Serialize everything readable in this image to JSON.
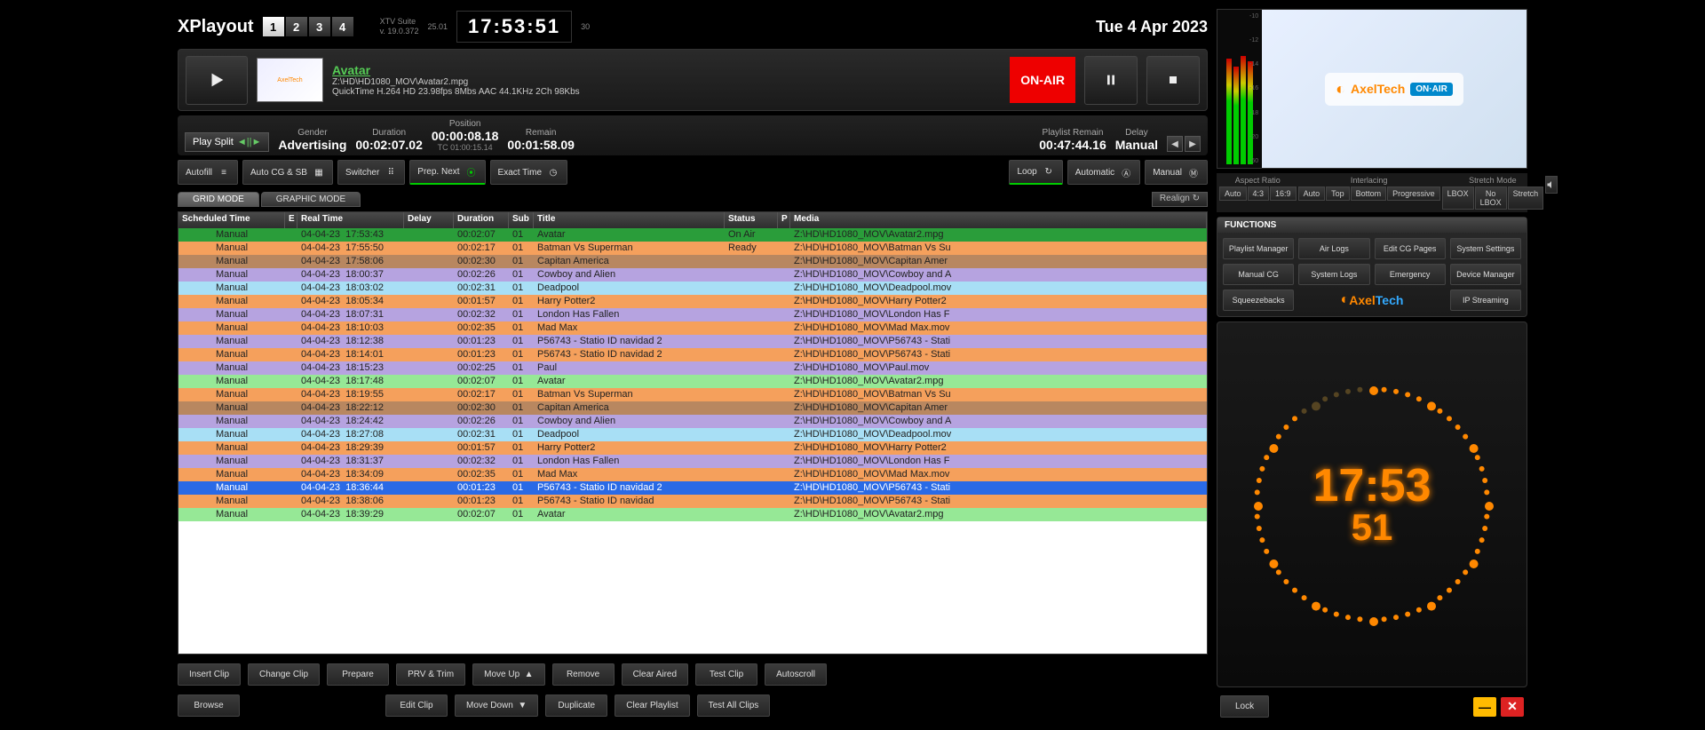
{
  "app": {
    "title": "XPlayout",
    "suite": "XTV Suite",
    "version": "v. 19.0.372"
  },
  "channels": [
    "1",
    "2",
    "3",
    "4"
  ],
  "clock_small_left": "25.01",
  "clock": "17:53:51",
  "clock_small_right": "30",
  "date": "Tue 4 Apr 2023",
  "now_playing": {
    "title": "Avatar",
    "path": "Z:\\HD\\HD1080_MOV\\Avatar2.mpg",
    "codec": "QuickTime H.264 HD 23.98fps 8Mbs AAC 44.1KHz 2Ch 98Kbs",
    "onair": "ON-AIR"
  },
  "play_split": "Play Split",
  "stats": {
    "gender": {
      "label": "Gender",
      "value": "Advertising"
    },
    "duration": {
      "label": "Duration",
      "value": "00:02:07.02"
    },
    "position": {
      "label": "Position",
      "value": "00:00:08.18",
      "tc": "TC 01:00:15.14"
    },
    "remain": {
      "label": "Remain",
      "value": "00:01:58.09"
    },
    "playlist_remain": {
      "label": "Playlist Remain",
      "value": "00:47:44.16"
    },
    "delay": {
      "label": "Delay",
      "value": "Manual"
    }
  },
  "mode_btns": {
    "autofill": "Autofill",
    "autocg": "Auto CG & SB",
    "switcher": "Switcher",
    "prepnext": "Prep. Next",
    "exacttime": "Exact Time",
    "loop": "Loop",
    "automatic": "Automatic",
    "manual": "Manual"
  },
  "tabs": {
    "grid": "GRID MODE",
    "graphic": "GRAPHIC MODE",
    "realign": "Realign"
  },
  "columns": {
    "sched": "Scheduled Time",
    "e": "E",
    "real": "Real Time",
    "delay": "Delay",
    "dur": "Duration",
    "sub": "Sub",
    "title": "Title",
    "status": "Status",
    "p": "P",
    "media": "Media"
  },
  "rows": [
    {
      "sched": "Manual",
      "rd": "04-04-23",
      "rt": "17:53:43",
      "dur": "00:02:07",
      "sub": "01",
      "title": "Avatar",
      "status": "On Air",
      "media": "Z:\\HD\\HD1080_MOV\\Avatar2.mpg",
      "color": "#2a9d3a"
    },
    {
      "sched": "Manual",
      "rd": "04-04-23",
      "rt": "17:55:50",
      "dur": "00:02:17",
      "sub": "01",
      "title": "Batman Vs Superman",
      "status": "Ready",
      "media": "Z:\\HD\\HD1080_MOV\\Batman Vs Su",
      "color": "#f5a05c"
    },
    {
      "sched": "Manual",
      "rd": "04-04-23",
      "rt": "17:58:06",
      "dur": "00:02:30",
      "sub": "01",
      "title": "Capitan America",
      "status": "",
      "media": "Z:\\HD\\HD1080_MOV\\Capitan Amer",
      "color": "#b88760"
    },
    {
      "sched": "Manual",
      "rd": "04-04-23",
      "rt": "18:00:37",
      "dur": "00:02:26",
      "sub": "01",
      "title": "Cowboy and Alien",
      "status": "",
      "media": "Z:\\HD\\HD1080_MOV\\Cowboy and A",
      "color": "#b6a3e0"
    },
    {
      "sched": "Manual",
      "rd": "04-04-23",
      "rt": "18:03:02",
      "dur": "00:02:31",
      "sub": "01",
      "title": "Deadpool",
      "status": "",
      "media": "Z:\\HD\\HD1080_MOV\\Deadpool.mov",
      "color": "#a8dff5"
    },
    {
      "sched": "Manual",
      "rd": "04-04-23",
      "rt": "18:05:34",
      "dur": "00:01:57",
      "sub": "01",
      "title": "Harry Potter2",
      "status": "",
      "media": "Z:\\HD\\HD1080_MOV\\Harry Potter2",
      "color": "#f5a05c"
    },
    {
      "sched": "Manual",
      "rd": "04-04-23",
      "rt": "18:07:31",
      "dur": "00:02:32",
      "sub": "01",
      "title": "London Has Fallen",
      "status": "",
      "media": "Z:\\HD\\HD1080_MOV\\London Has F",
      "color": "#b6a3e0"
    },
    {
      "sched": "Manual",
      "rd": "04-04-23",
      "rt": "18:10:03",
      "dur": "00:02:35",
      "sub": "01",
      "title": "Mad Max",
      "status": "",
      "media": "Z:\\HD\\HD1080_MOV\\Mad Max.mov",
      "color": "#f5a05c"
    },
    {
      "sched": "Manual",
      "rd": "04-04-23",
      "rt": "18:12:38",
      "dur": "00:01:23",
      "sub": "01",
      "title": "P56743 - Statio ID navidad 2",
      "status": "",
      "media": "Z:\\HD\\HD1080_MOV\\P56743 - Stati",
      "color": "#b6a3e0"
    },
    {
      "sched": "Manual",
      "rd": "04-04-23",
      "rt": "18:14:01",
      "dur": "00:01:23",
      "sub": "01",
      "title": "P56743 - Statio ID navidad 2",
      "status": "",
      "media": "Z:\\HD\\HD1080_MOV\\P56743 - Stati",
      "color": "#f5a05c"
    },
    {
      "sched": "Manual",
      "rd": "04-04-23",
      "rt": "18:15:23",
      "dur": "00:02:25",
      "sub": "01",
      "title": "Paul",
      "status": "",
      "media": "Z:\\HD\\HD1080_MOV\\Paul.mov",
      "color": "#b6a3e0"
    },
    {
      "sched": "Manual",
      "rd": "04-04-23",
      "rt": "18:17:48",
      "dur": "00:02:07",
      "sub": "01",
      "title": "Avatar",
      "status": "",
      "media": "Z:\\HD\\HD1080_MOV\\Avatar2.mpg",
      "color": "#96e896"
    },
    {
      "sched": "Manual",
      "rd": "04-04-23",
      "rt": "18:19:55",
      "dur": "00:02:17",
      "sub": "01",
      "title": "Batman Vs Superman",
      "status": "",
      "media": "Z:\\HD\\HD1080_MOV\\Batman Vs Su",
      "color": "#f5a05c"
    },
    {
      "sched": "Manual",
      "rd": "04-04-23",
      "rt": "18:22:12",
      "dur": "00:02:30",
      "sub": "01",
      "title": "Capitan America",
      "status": "",
      "media": "Z:\\HD\\HD1080_MOV\\Capitan Amer",
      "color": "#b88760"
    },
    {
      "sched": "Manual",
      "rd": "04-04-23",
      "rt": "18:24:42",
      "dur": "00:02:26",
      "sub": "01",
      "title": "Cowboy and Alien",
      "status": "",
      "media": "Z:\\HD\\HD1080_MOV\\Cowboy and A",
      "color": "#b6a3e0"
    },
    {
      "sched": "Manual",
      "rd": "04-04-23",
      "rt": "18:27:08",
      "dur": "00:02:31",
      "sub": "01",
      "title": "Deadpool",
      "status": "",
      "media": "Z:\\HD\\HD1080_MOV\\Deadpool.mov",
      "color": "#a8dff5"
    },
    {
      "sched": "Manual",
      "rd": "04-04-23",
      "rt": "18:29:39",
      "dur": "00:01:57",
      "sub": "01",
      "title": "Harry Potter2",
      "status": "",
      "media": "Z:\\HD\\HD1080_MOV\\Harry Potter2",
      "color": "#f5a05c"
    },
    {
      "sched": "Manual",
      "rd": "04-04-23",
      "rt": "18:31:37",
      "dur": "00:02:32",
      "sub": "01",
      "title": "London Has Fallen",
      "status": "",
      "media": "Z:\\HD\\HD1080_MOV\\London Has F",
      "color": "#b6a3e0"
    },
    {
      "sched": "Manual",
      "rd": "04-04-23",
      "rt": "18:34:09",
      "dur": "00:02:35",
      "sub": "01",
      "title": "Mad Max",
      "status": "",
      "media": "Z:\\HD\\HD1080_MOV\\Mad Max.mov",
      "color": "#f5a05c"
    },
    {
      "sched": "Manual",
      "rd": "04-04-23",
      "rt": "18:36:44",
      "dur": "00:01:23",
      "sub": "01",
      "title": "P56743 - Statio ID navidad 2",
      "status": "",
      "media": "Z:\\HD\\HD1080_MOV\\P56743 - Stati",
      "color": "#2a6ae6",
      "fg": "#fff"
    },
    {
      "sched": "Manual",
      "rd": "04-04-23",
      "rt": "18:38:06",
      "dur": "00:01:23",
      "sub": "01",
      "title": "P56743 - Statio ID navidad",
      "status": "",
      "media": "Z:\\HD\\HD1080_MOV\\P56743 - Stati",
      "color": "#f5a05c"
    },
    {
      "sched": "Manual",
      "rd": "04-04-23",
      "rt": "18:39:29",
      "dur": "00:02:07",
      "sub": "01",
      "title": "Avatar",
      "status": "",
      "media": "Z:\\HD\\HD1080_MOV\\Avatar2.mpg",
      "color": "#96e896"
    }
  ],
  "actions": {
    "row1": [
      "Insert Clip",
      "Change Clip",
      "Prepare",
      "PRV & Trim",
      "Move Up",
      "Remove",
      "Clear Aired",
      "Test Clip",
      "Autoscroll"
    ],
    "row2": [
      "Browse",
      "",
      "",
      "Edit Clip",
      "Move Down",
      "Duplicate",
      "Clear Playlist",
      "Test All Clips",
      ""
    ]
  },
  "aspect": {
    "ar_label": "Aspect Ratio",
    "ar_opts": [
      "Auto",
      "4:3",
      "16:9"
    ],
    "il_label": "Interlacing",
    "il_opts": [
      "Auto",
      "Top",
      "Bottom",
      "Progressive"
    ],
    "sm_label": "Stretch Mode",
    "sm_opts": [
      "LBOX",
      "No LBOX",
      "Stretch"
    ]
  },
  "meter_scale": [
    "-10",
    "-12",
    "-14",
    "-16",
    "-18",
    "-20",
    "-50"
  ],
  "functions": {
    "title": "FUNCTIONS",
    "buttons": [
      "Playlist Manager",
      "Air Logs",
      "Edit CG Pages",
      "System Settings",
      "Manual CG",
      "System Logs",
      "Emergency",
      "Device Manager",
      "Squeezebacks",
      "",
      "",
      "IP Streaming"
    ],
    "brand": "AxelTech"
  },
  "big_clock": {
    "hm": "17:53",
    "s": "51"
  },
  "lock": "Lock",
  "preview_brand": "AxelTech",
  "preview_onair": "ON·AIR"
}
